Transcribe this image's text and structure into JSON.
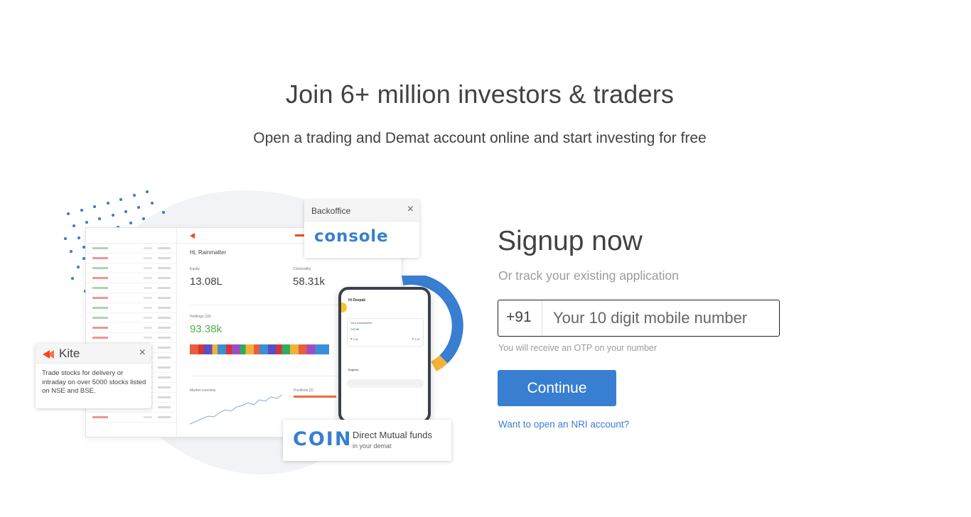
{
  "hero": {
    "title": "Join 6+ million investors & traders",
    "subtitle": "Open a trading and Demat account online and start investing for free"
  },
  "illustration": {
    "dashboard": {
      "greeting": "Hi, Rainmatter",
      "equity_label": "Equity",
      "equity_value": "13.08L",
      "commodity_label": "Commodity",
      "commodity_value": "58.31k",
      "holdings_label": "Holdings (18)",
      "holdings_value": "93.38k",
      "market_overview_label": "Market overview",
      "positions_label": "Positions (2)"
    },
    "backoffice_card": {
      "title": "Backoffice",
      "logo_text": "console"
    },
    "kite_card": {
      "name": "Kite",
      "description": "Trade stocks for delivery or intraday on over 5000 stocks listed on NSE and BSE."
    },
    "coin_card": {
      "logo_text": "COIN",
      "title": "Direct Mutual funds",
      "subtitle": "in your demat"
    },
    "phone": {
      "greeting": "Hi Deepak",
      "investments_label": "Your investments",
      "investments_value": "+47.9k",
      "invested_value": "₹ 2.2L",
      "current_value": "₹ 2.4L",
      "explore_label": "Explore"
    },
    "colors": {
      "brand_blue": "#387ed1",
      "kite_orange": "#f6461a",
      "donut_yellow": "#f5b335"
    }
  },
  "signup": {
    "title": "Signup now",
    "subtitle": "Or track your existing application",
    "country_code": "+91",
    "mobile_placeholder": "Your 10 digit mobile number",
    "otp_note": "You will receive an OTP on your number",
    "continue_label": "Continue",
    "nri_link": "Want to open an NRI account?"
  }
}
